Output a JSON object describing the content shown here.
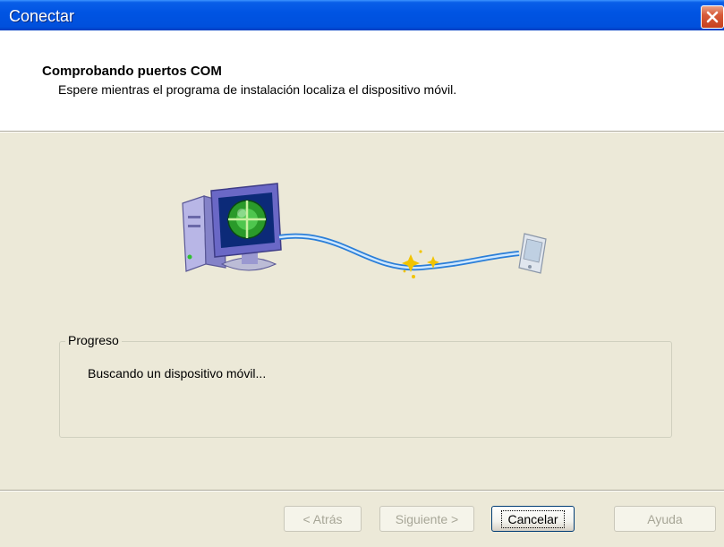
{
  "window": {
    "title": "Conectar"
  },
  "header": {
    "title": "Comprobando puertos COM",
    "subtitle": "Espere mientras el programa de instalación localiza el dispositivo móvil."
  },
  "progress": {
    "legend": "Progreso",
    "status": "Buscando un dispositivo móvil..."
  },
  "buttons": {
    "back": "< Atrás",
    "next": "Siguiente >",
    "cancel": "Cancelar",
    "help": "Ayuda"
  },
  "icons": {
    "close": "close-icon",
    "computer": "computer-globe-icon",
    "device": "mobile-device-icon"
  },
  "colors": {
    "title_bar": "#0054e3",
    "dialog_bg": "#ece9d8",
    "close_button": "#d75b3a"
  }
}
